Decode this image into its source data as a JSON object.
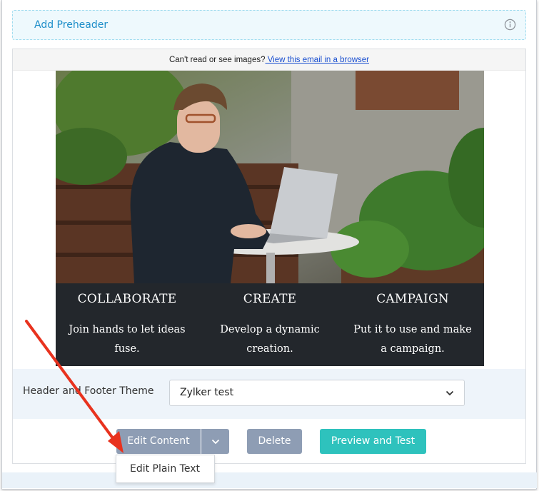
{
  "preheader": {
    "label": "Add Preheader",
    "icon": "info-icon"
  },
  "email": {
    "view_prompt": "Can't read or see images?",
    "view_link": " View this email in a browser",
    "features": [
      {
        "title": "COLLABORATE",
        "desc": "Join hands to let ideas fuse."
      },
      {
        "title": "CREATE",
        "desc": "Develop a dynamic creation."
      },
      {
        "title": "CAMPAIGN",
        "desc": "Put it to use and make a campaign."
      }
    ]
  },
  "theme": {
    "label": "Header and Footer Theme",
    "selected": "Zylker test"
  },
  "actions": {
    "edit_content": "Edit Content",
    "delete": "Delete",
    "preview": "Preview and Test",
    "dropdown_item": "Edit Plain Text"
  },
  "colors": {
    "accent_teal": "#2ec2bd",
    "button_gray": "#8e9db4",
    "link_blue": "#1d8ec9",
    "annotation_arrow": "#e8321e"
  }
}
